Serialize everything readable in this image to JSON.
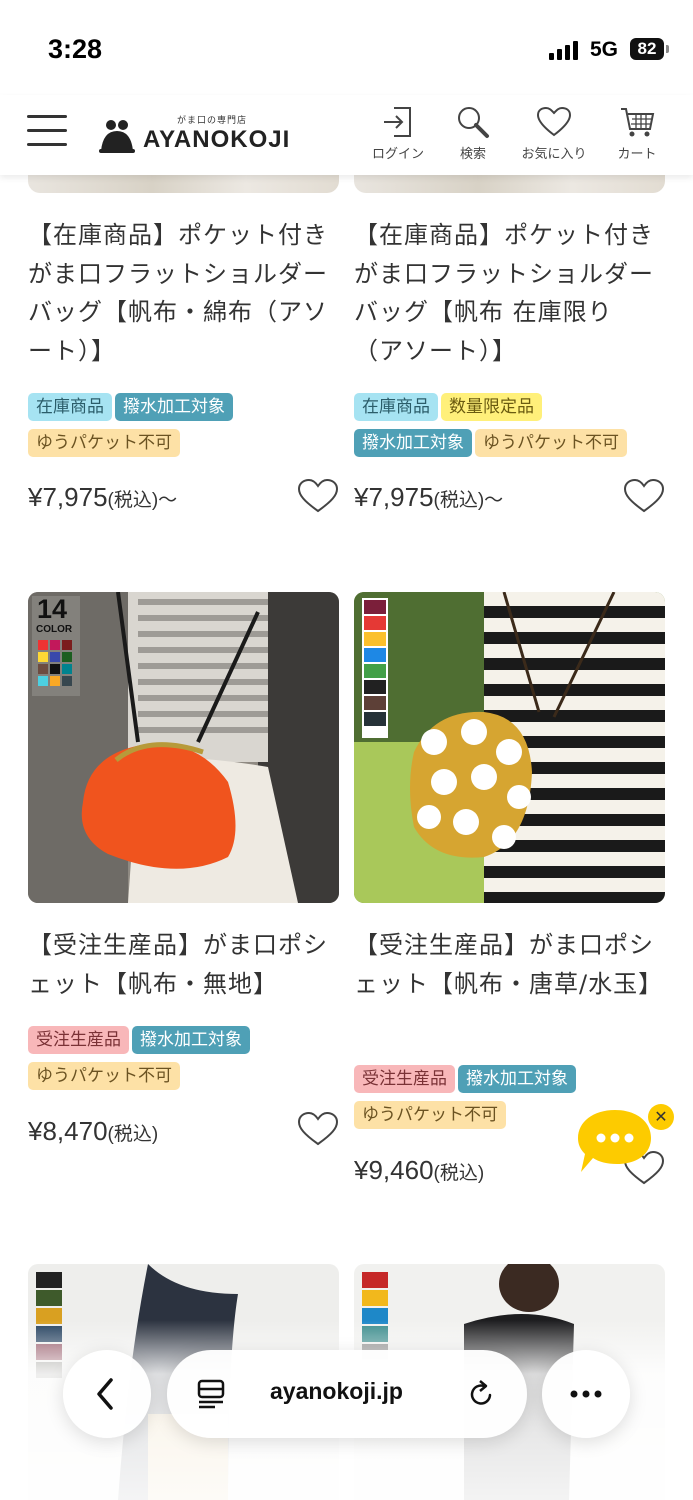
{
  "status_bar": {
    "time": "3:28",
    "network": "5G",
    "battery": "82"
  },
  "header": {
    "logo_sub": "がま口の専門店",
    "logo_name": "AYANOKOJI",
    "nav": {
      "login": "ログイン",
      "search": "検索",
      "favorites": "お気に入り",
      "cart": "カート"
    }
  },
  "products": [
    {
      "title": "【在庫商品】ポケット付きがま口フラットショルダーバッグ【帆布・綿布（アソート）】",
      "tags": [
        "在庫商品",
        "撥水加工対象",
        "ゆうパケット不可"
      ],
      "price": "¥7,975",
      "price_suffix": "(税込)〜"
    },
    {
      "title": "【在庫商品】ポケット付きがま口フラットショルダーバッグ【帆布 在庫限り（アソート）】",
      "tags": [
        "在庫商品",
        "数量限定品",
        "撥水加工対象",
        "ゆうパケット不可"
      ],
      "price": "¥7,975",
      "price_suffix": "(税込)〜"
    },
    {
      "title": "【受注生産品】がま口ポシェット【帆布・無地】",
      "badge_count": "14",
      "badge_label": "COLOR",
      "tags": [
        "受注生産品",
        "撥水加工対象",
        "ゆうパケット不可"
      ],
      "price": "¥8,470",
      "price_suffix": "(税込)"
    },
    {
      "title": "【受注生産品】がま口ポシェット【帆布・唐草/水玉】",
      "tags": [
        "受注生産品",
        "撥水加工対象",
        "ゆうパケット不可"
      ],
      "price": "¥9,460",
      "price_suffix": "(税込)"
    }
  ],
  "browser": {
    "url": "ayanokoji.jp"
  },
  "icons": {
    "menu": "hamburger-menu-icon",
    "login": "login-icon",
    "search": "search-icon",
    "favorites": "heart-icon",
    "cart": "cart-icon",
    "back": "chevron-left-icon",
    "tabs": "tab-overview-icon",
    "reload": "reload-icon",
    "more": "more-icon",
    "chat": "chat-icon"
  },
  "colors": {
    "tag_stock": "#a6e3f2",
    "tag_water": "#4fa0b6",
    "tag_mail": "#fde1a6",
    "tag_limited": "#fff07a",
    "tag_order": "#f8b7b9",
    "chat": "#fdcb00"
  }
}
